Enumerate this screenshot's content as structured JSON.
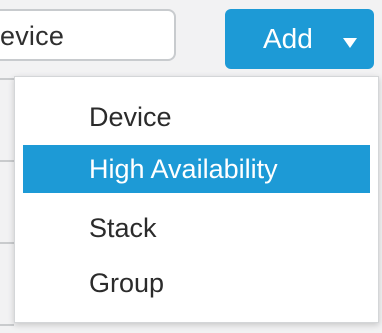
{
  "search": {
    "value": "evice"
  },
  "add_button": {
    "label": "Add",
    "icon": "caret-down-icon"
  },
  "menu": {
    "items": [
      {
        "label": "Device",
        "selected": false
      },
      {
        "label": "High Availability",
        "selected": true
      },
      {
        "label": "Stack",
        "selected": false
      },
      {
        "label": "Group",
        "selected": false
      }
    ]
  },
  "colors": {
    "accent": "#1d9ad6",
    "menu_background": "#ffffff",
    "text": "#2b2b2b",
    "page_background": "#f2f2f3"
  }
}
